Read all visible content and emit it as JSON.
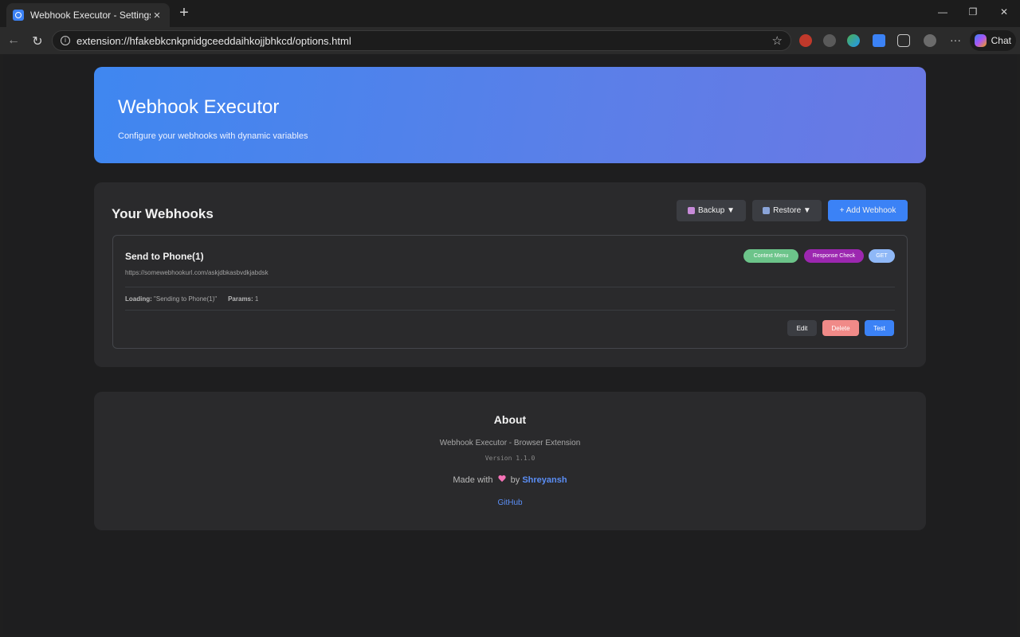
{
  "browser": {
    "tab_title": "Webhook Executor - Settings",
    "url": "extension://hfakebkcnkpnidgceeddaihkojjbhkcd/options.html",
    "chat_label": "Chat"
  },
  "hero": {
    "title": "Webhook Executor",
    "subtitle": "Configure your webhooks with dynamic variables"
  },
  "webhooks_section": {
    "title": "Your Webhooks",
    "backup_label": "Backup ▼",
    "restore_label": "Restore ▼",
    "add_label": "+ Add Webhook",
    "items": [
      {
        "name": "Send to Phone(1)",
        "url": "https://somewebhookurl.com/askjdbkasbvdkjabdsk",
        "badges": {
          "context_menu": "Context Menu",
          "response_check": "Response Check",
          "method": "GET"
        },
        "loading_label": "Loading:",
        "loading_value": "\"Sending to Phone(1)\"",
        "params_label": "Params:",
        "params_value": "1",
        "edit_label": "Edit",
        "delete_label": "Delete",
        "test_label": "Test"
      }
    ]
  },
  "about": {
    "title": "About",
    "description": "Webhook Executor - Browser Extension",
    "version": "Version 1.1.0",
    "made_with": "Made with",
    "by": "by",
    "author": "Shreyansh",
    "github": "GitHub"
  },
  "colors": {
    "accent_blue": "#3b82f6",
    "badge_context_menu": "#6cc48a",
    "badge_response_check": "#9c27b0",
    "badge_method": "#8fb8f7",
    "delete": "#f08a88"
  }
}
